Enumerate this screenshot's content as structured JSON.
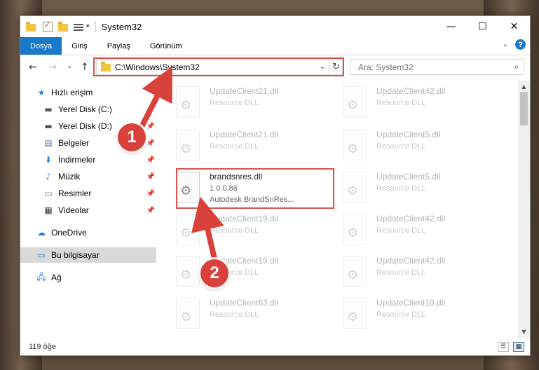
{
  "window": {
    "title": "System32"
  },
  "controls": {
    "minimize": "—",
    "maximize": "☐",
    "close": "✕"
  },
  "ribbon": {
    "tabs": [
      {
        "label": "Dosya",
        "active": true
      },
      {
        "label": "Giriş"
      },
      {
        "label": "Paylaş"
      },
      {
        "label": "Görünüm"
      }
    ],
    "help": "?"
  },
  "nav": {
    "back": "←",
    "forward": "→",
    "recent": "⌄",
    "up": "↑",
    "address": "C:\\Windows\\System32",
    "refresh": "↻",
    "search_placeholder": "Ara: System32"
  },
  "sidebar": {
    "items": [
      {
        "label": "Hızlı erişim",
        "icon": "star-icon"
      },
      {
        "label": "Yerel Disk (C:)",
        "icon": "drive-icon",
        "pinned": true
      },
      {
        "label": "Yerel Disk (D:)",
        "icon": "drive-icon",
        "pinned": true
      },
      {
        "label": "Belgeler",
        "icon": "document-icon",
        "pinned": true
      },
      {
        "label": "İndirmeler",
        "icon": "download-icon",
        "pinned": true
      },
      {
        "label": "Müzik",
        "icon": "music-icon",
        "pinned": true
      },
      {
        "label": "Resimler",
        "icon": "pictures-icon",
        "pinned": true
      },
      {
        "label": "Videolar",
        "icon": "video-icon",
        "pinned": true
      },
      {
        "label": "OneDrive",
        "icon": "cloud-icon"
      },
      {
        "label": "Bu bilgisayar",
        "icon": "computer-icon",
        "selected": true
      },
      {
        "label": "Ağ",
        "icon": "network-icon"
      }
    ]
  },
  "files": {
    "left": [
      {
        "name": "UpdateClient21.dll",
        "type": "Resource DLL"
      },
      {
        "name": "UpdateClient21.dll",
        "type": "Resource DLL"
      },
      {
        "name": "brandsnres.dll",
        "version": "1.0.0.86",
        "company": "Autodesk BrandSnRes...",
        "highlighted": true
      },
      {
        "name": "UpdateClient19.dll",
        "type": "Resource DLL"
      },
      {
        "name": "UpdateClient19.dll",
        "type": "Resource DLL"
      },
      {
        "name": "UpdateClient63.dll",
        "type": "Resource DLL"
      }
    ],
    "right": [
      {
        "name": "UpdateClient42.dll",
        "type": "Resource DLL"
      },
      {
        "name": "UpdateClient5.dll",
        "type": "Resource DLL"
      },
      {
        "name": "UpdateClient5.dll",
        "type": "Resource DLL"
      },
      {
        "name": "UpdateClient42.dll",
        "type": "Resource DLL"
      },
      {
        "name": "UpdateClient42.dll",
        "type": "Resource DLL"
      },
      {
        "name": "UpdateClient19.dll",
        "type": "Resource DLL"
      }
    ]
  },
  "status": {
    "count": "119 öğe"
  },
  "callouts": {
    "one": "1",
    "two": "2"
  },
  "colors": {
    "accent": "#1979ca",
    "highlight": "#d9534f",
    "callout": "#d9413b"
  }
}
